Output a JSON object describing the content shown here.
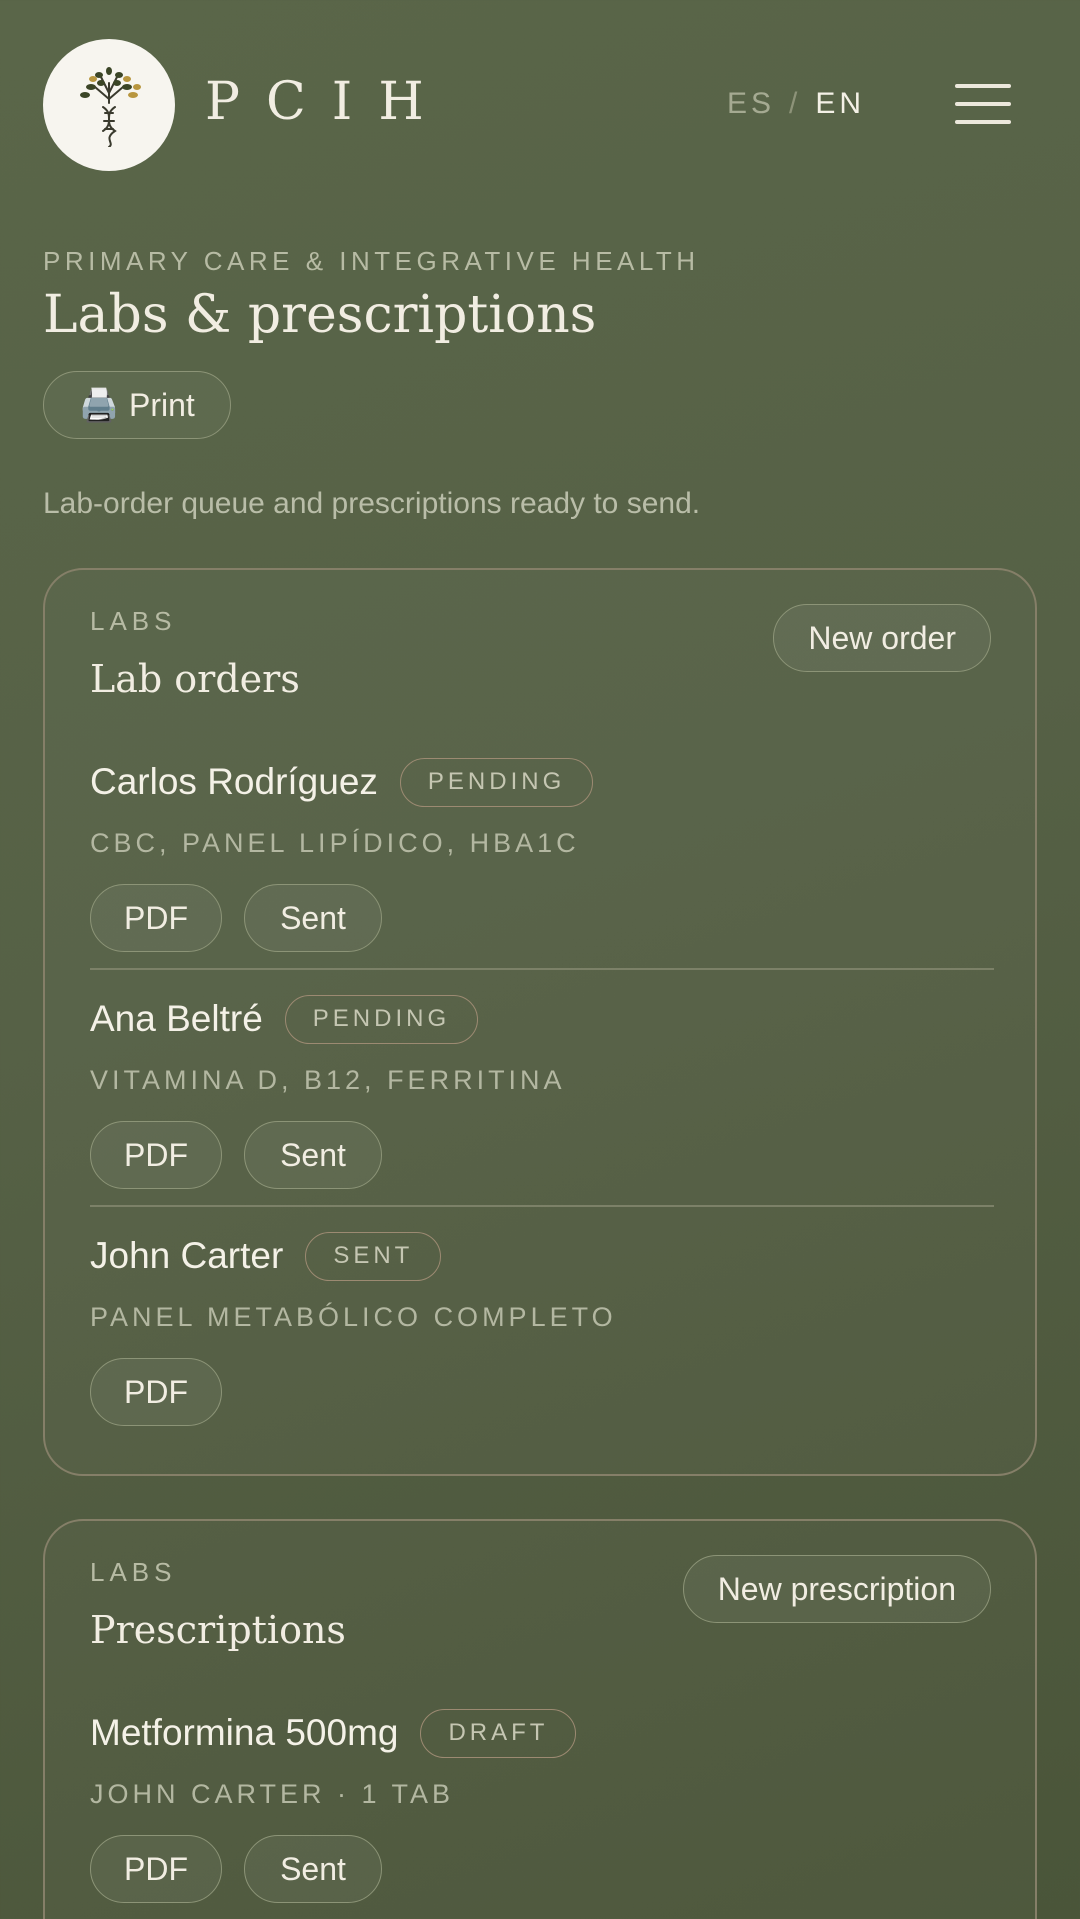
{
  "header": {
    "brand": "PCIH",
    "lang_es": "ES",
    "lang_sep": "/",
    "lang_en": "EN"
  },
  "page": {
    "eyebrow": "PRIMARY CARE & INTEGRATIVE HEALTH",
    "title": "Labs & prescriptions",
    "print_icon": "🖨️",
    "print_label": "Print",
    "intro": "Lab-order queue and prescriptions ready to send."
  },
  "lab_orders": {
    "eyebrow": "LABS",
    "title": "Lab orders",
    "action": "New order",
    "items": [
      {
        "name": "Carlos Rodríguez",
        "status": "PENDING",
        "meta": "CBC, PANEL LIPÍDICO, HBA1C",
        "pdf": "PDF",
        "sent": "Sent"
      },
      {
        "name": "Ana Beltré",
        "status": "PENDING",
        "meta": "VITAMINA D, B12, FERRITINA",
        "pdf": "PDF",
        "sent": "Sent"
      },
      {
        "name": "John Carter",
        "status": "SENT",
        "meta": "PANEL METABÓLICO COMPLETO",
        "pdf": "PDF"
      }
    ]
  },
  "prescriptions": {
    "eyebrow": "LABS",
    "title": "Prescriptions",
    "action": "New prescription",
    "items": [
      {
        "name": "Metformina 500mg",
        "status": "DRAFT",
        "meta": "JOHN CARTER · 1 TAB",
        "pdf": "PDF",
        "sent": "Sent"
      }
    ]
  }
}
